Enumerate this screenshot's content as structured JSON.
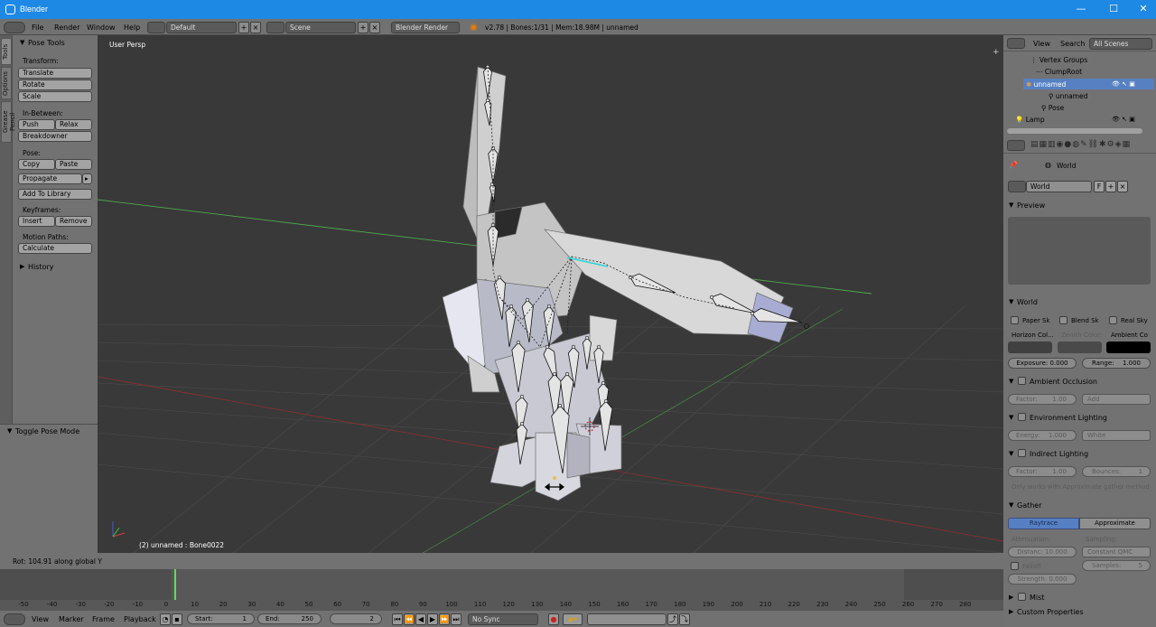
{
  "window": {
    "title": "Blender",
    "min_label": "—",
    "max_label": "☐",
    "close_label": "✕"
  },
  "menubar": {
    "items": [
      "File",
      "Render",
      "Window",
      "Help"
    ],
    "layout": "Default",
    "scene": "Scene",
    "engine": "Blender Render",
    "info": "v2.78 | Bones:1/31 | Mem:18.98M | unnamed"
  },
  "toolshelf": {
    "tabs": [
      "Tools",
      "Options",
      "Grease Pencil"
    ],
    "panel_title": "Pose Tools",
    "transform_label": "Transform:",
    "translate": "Translate",
    "rotate": "Rotate",
    "scale": "Scale",
    "inbetween_label": "In-Between:",
    "push": "Push",
    "relax": "Relax",
    "breakdowner": "Breakdowner",
    "pose_label": "Pose:",
    "copy": "Copy",
    "paste": "Paste",
    "propagate": "Propagate",
    "add_to_library": "Add To Library",
    "keyframes_label": "Keyframes:",
    "insert": "Insert",
    "remove": "Remove",
    "motion_paths_label": "Motion Paths:",
    "calculate": "Calculate",
    "history": "History",
    "toggle_pose_mode": "Toggle Pose Mode"
  },
  "viewport": {
    "view_label": "User Persp",
    "object_label": "(2) unnamed : Bone0022"
  },
  "status": {
    "text": "Rot: 104.91 along global Y"
  },
  "timeline": {
    "ticks": [
      "-50",
      "-40",
      "-30",
      "-20",
      "-10",
      "0",
      "10",
      "20",
      "30",
      "40",
      "50",
      "60",
      "70",
      "80",
      "90",
      "100",
      "110",
      "120",
      "130",
      "140",
      "150",
      "160",
      "170",
      "180",
      "190",
      "200",
      "210",
      "220",
      "230",
      "240",
      "250",
      "260",
      "270",
      "280"
    ],
    "current_frame": 2,
    "menu": [
      "View",
      "Marker",
      "Frame",
      "Playback"
    ],
    "start_label": "Start:",
    "start_value": "1",
    "end_label": "End:",
    "end_value": "250",
    "frame_value": "2",
    "sync": "No Sync"
  },
  "outliner": {
    "menu": [
      "View",
      "Search"
    ],
    "scenes": "All Scenes",
    "items": [
      "Vertex Groups",
      "ClumpRoot",
      "unnamed",
      "unnamed",
      "Pose",
      "Lamp"
    ]
  },
  "properties": {
    "context_label": "World",
    "world_name": "World",
    "fake_user": "F",
    "preview_title": "Preview",
    "world_title": "World",
    "paper_sky": "Paper Sk",
    "blend_sky": "Blend Sk",
    "real_sky": "Real Sky",
    "horizon_color": "Horizon Col...",
    "zenith_color": "Zenith Color:",
    "ambient_color": "Ambient Co",
    "exposure": "Exposure: 0.000",
    "range": "Range:",
    "range_value": "1.000",
    "ao_title": "Ambient Occlusion",
    "ao_factor_label": "Factor:",
    "ao_factor_value": "1.00",
    "ao_mode": "Add",
    "env_title": "Environment Lighting",
    "env_energy_label": "Energy:",
    "env_energy_value": "1.000",
    "env_color": "White",
    "indirect_title": "Indirect Lighting",
    "ind_factor_label": "Factor:",
    "ind_factor_value": "1.00",
    "bounces_label": "Bounces:",
    "bounces_value": "1",
    "indirect_note": "Only works with Approximate gather method",
    "gather_title": "Gather",
    "raytrace": "Raytrace",
    "approximate": "Approximate",
    "attenuation_label": "Attenuation:",
    "sampling_label": "Sampling:",
    "distance": "Distanc: 10.000",
    "sampling_method": "Constant QMC",
    "falloff": "Falloff",
    "samples_label": "Samples:",
    "samples_value": "5",
    "strength": "Strength: 0.000",
    "mist_title": "Mist",
    "custom_props_title": "Custom Properties"
  },
  "colors": {
    "titlebar": "#1e88e5",
    "panel": "#727272",
    "viewport": "#393939",
    "selected": "#5680c2"
  }
}
